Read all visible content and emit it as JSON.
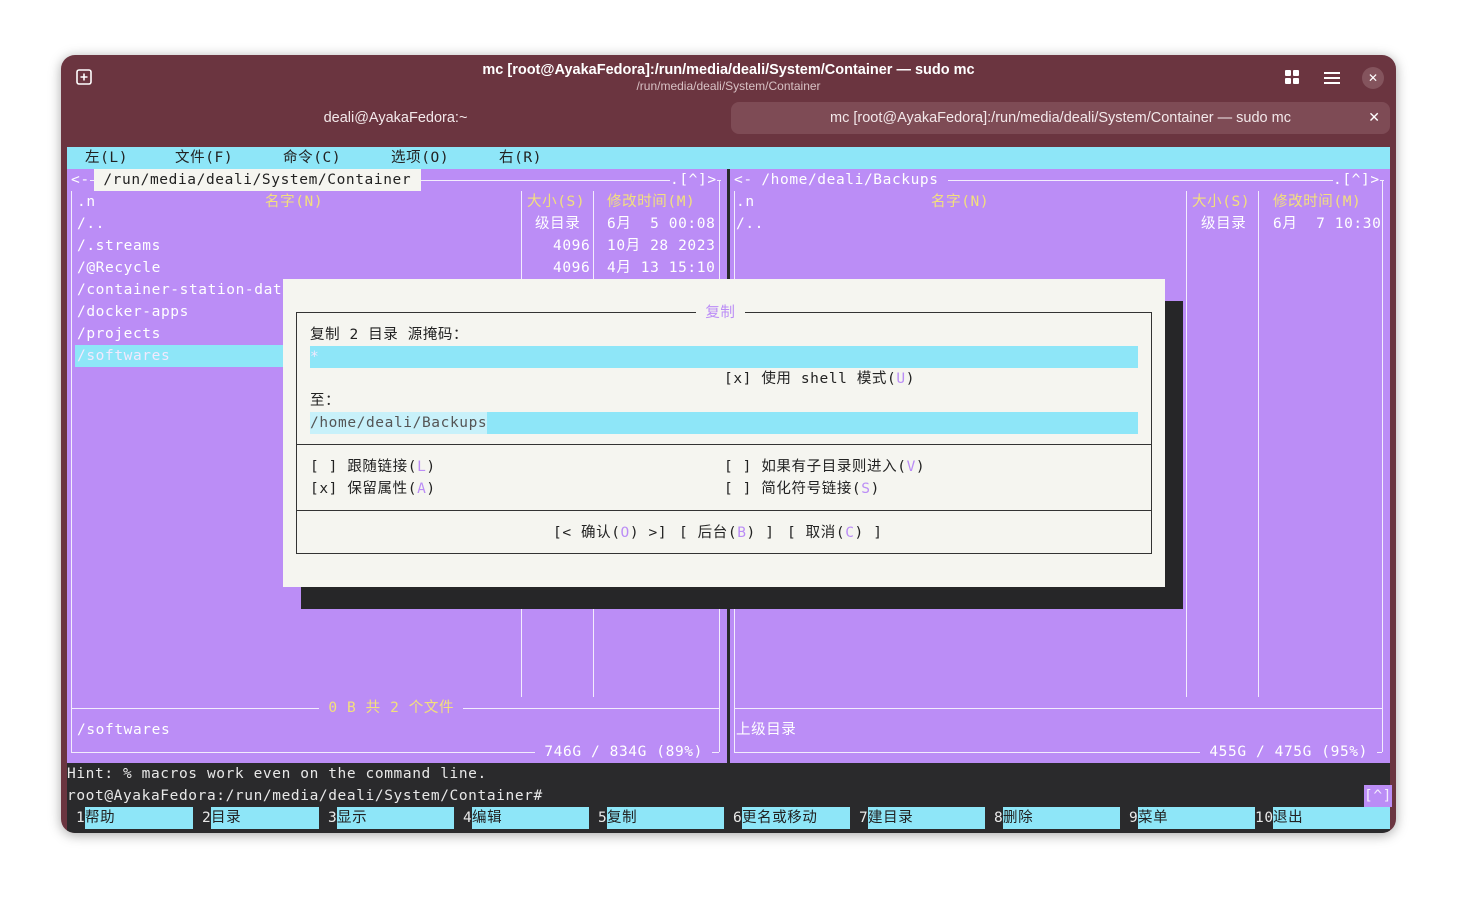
{
  "window": {
    "title": "mc [root@AyakaFedora]:/run/media/deali/System/Container — sudo mc",
    "subtitle": "/run/media/deali/System/Container",
    "new_tab_icon": "plus-square-icon",
    "grid_icon": "grid-icon",
    "menu_icon": "hamburger-icon",
    "close_icon": "close-icon",
    "close_glyph": "✕"
  },
  "tabs": [
    {
      "label": "deali@AyakaFedora:~"
    },
    {
      "label": "mc [root@AyakaFedora]:/run/media/deali/System/Container — sudo mc",
      "close": "✕"
    }
  ],
  "menubar": [
    "左(L)",
    "文件(F)",
    "命令(C)",
    "选项(O)",
    "右(R)"
  ],
  "left_panel": {
    "path": " /run/media/deali/System/Container ",
    "corner_left": "<-",
    "corner_right": ".[^]>",
    "headers": {
      "sort": ".n",
      "name": "名字(N)",
      "size": "大小(S)",
      "mtime": "修改时间(M)"
    },
    "rows": [
      {
        "name": "/..",
        "size": "级目录",
        "mtime": "6月  5 00:08"
      },
      {
        "name": "/.streams",
        "size": "4096",
        "mtime": "10月 28 2023"
      },
      {
        "name": "/@Recycle",
        "size": "4096",
        "mtime": "4月 13 15:10"
      },
      {
        "name": "/container-station-data",
        "size": "",
        "mtime": ""
      },
      {
        "name": "/docker-apps",
        "size": "",
        "mtime": ""
      },
      {
        "name": "/projects",
        "size": "",
        "mtime": ""
      },
      {
        "name": "/softwares",
        "size": "",
        "mtime": ""
      }
    ],
    "summary": " 0 B 共 2 个文件 ",
    "status": "/softwares",
    "disk": " 746G / 834G (89%) "
  },
  "right_panel": {
    "path": " /home/deali/Backups ",
    "corner_left": "<-",
    "corner_right": ".[^]>",
    "headers": {
      "sort": ".n",
      "name": "名字(N)",
      "size": "大小(S)",
      "mtime": "修改时间(M)"
    },
    "rows": [
      {
        "name": "/..",
        "size": "级目录",
        "mtime": "6月  7 10:30"
      }
    ],
    "status": "上级目录",
    "disk": " 455G / 475G (95%) "
  },
  "dialog": {
    "title": " 复制 ",
    "source_label": "复制 2 目录 源掩码：",
    "source_value": "*",
    "shell_mode": {
      "prefix": "[x] 使用 shell 模式(",
      "hotkey": "U",
      "suffix": ")"
    },
    "dest_label": "至：",
    "dest_value": "/home/deali/Backups",
    "opt_follow": {
      "prefix": "[ ] 跟随链接(",
      "hotkey": "L",
      "suffix": ")"
    },
    "opt_preserve": {
      "prefix": "[x] 保留属性(",
      "hotkey": "A",
      "suffix": ")"
    },
    "opt_dive": {
      "prefix": "[ ] 如果有子目录则进入(",
      "hotkey": "V",
      "suffix": ")"
    },
    "opt_stable": {
      "prefix": "[ ] 简化符号链接(",
      "hotkey": "S",
      "suffix": ")"
    },
    "btn_ok": {
      "prefix": "[< 确认(",
      "hotkey": "O",
      "suffix": ") >]"
    },
    "btn_bg": {
      "prefix": "[ 后台(",
      "hotkey": "B",
      "suffix": ") ]"
    },
    "btn_cancel": {
      "prefix": "[ 取消(",
      "hotkey": "C",
      "suffix": ") ]"
    }
  },
  "hint": "Hint: % macros work even on the command line.",
  "prompt": "root@AyakaFedora:/run/media/deali/System/Container#",
  "prompt_badge": "[^]",
  "fkeys": [
    {
      "num": "1",
      "label": "帮助"
    },
    {
      "num": "2",
      "label": "目录"
    },
    {
      "num": "3",
      "label": "显示"
    },
    {
      "num": "4",
      "label": "编辑"
    },
    {
      "num": "5",
      "label": "复制"
    },
    {
      "num": "6",
      "label": "更名或移动"
    },
    {
      "num": "7",
      "label": "建目录"
    },
    {
      "num": "8",
      "label": "删除"
    },
    {
      "num": "9",
      "label": "菜单"
    },
    {
      "num": "10",
      "label": "退出"
    }
  ],
  "colors": {
    "panel": "#bb8df6",
    "cyan": "#8ee6f8",
    "titlebar": "#6b3540",
    "header_yellow": "#f3e07c"
  }
}
